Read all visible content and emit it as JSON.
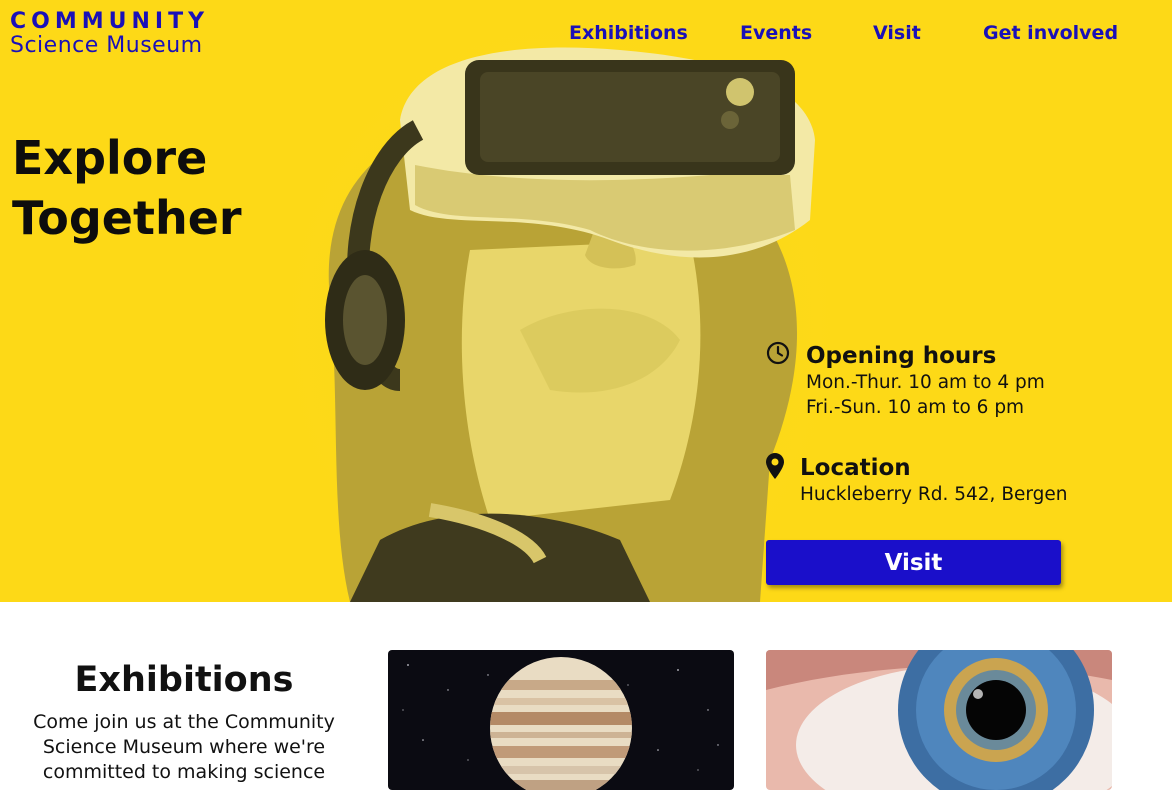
{
  "logo": {
    "line1": "COMMUNITY",
    "line2": "Science Museum"
  },
  "nav": {
    "items": [
      {
        "label": "Exhibitions"
      },
      {
        "label": "Events"
      },
      {
        "label": "Visit"
      },
      {
        "label": "Get involved"
      }
    ]
  },
  "hero": {
    "headline_line1": "Explore",
    "headline_line2": "Together",
    "opening_hours": {
      "icon": "clock-icon",
      "title": "Opening hours",
      "line1": "Mon.-Thur. 10 am to 4 pm",
      "line2": "Fri.-Sun. 10 am to 6 pm"
    },
    "location": {
      "icon": "map-pin-icon",
      "title": "Location",
      "address": "Huckleberry Rd. 542, Bergen"
    },
    "visit_button": "Visit"
  },
  "exhibitions": {
    "title": "Exhibitions",
    "text_line1": "Come join us at the Community",
    "text_line2": "Science Museum where we're",
    "text_line3": "committed to making science"
  },
  "colors": {
    "brand_yellow": "#fdd917",
    "brand_blue": "#1a10b8",
    "button_blue": "#1a0fca"
  }
}
